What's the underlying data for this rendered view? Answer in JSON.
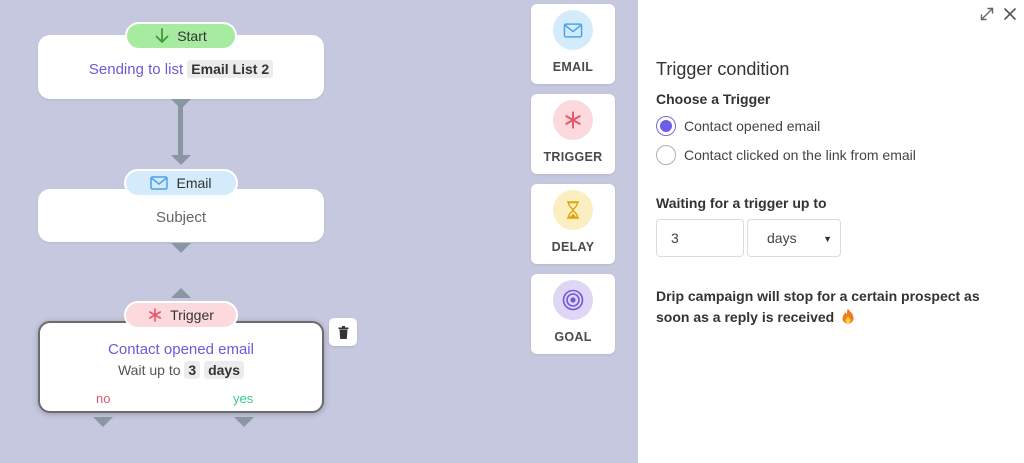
{
  "flow": {
    "start": {
      "pill_label": "Start",
      "text_prefix": "Sending to list",
      "list_name": "Email List 2"
    },
    "email": {
      "pill_label": "Email",
      "subject": "Subject"
    },
    "trigger": {
      "pill_label": "Trigger",
      "title": "Contact opened email",
      "wait_prefix": "Wait up to",
      "wait_value": "3",
      "wait_unit": "days",
      "branch_no": "no",
      "branch_yes": "yes"
    }
  },
  "palette": [
    {
      "label": "EMAIL",
      "icon": "envelope-icon",
      "color": "#d4ebfb"
    },
    {
      "label": "TRIGGER",
      "icon": "asterisk-icon",
      "color": "#fbd9dc"
    },
    {
      "label": "DELAY",
      "icon": "hourglass-icon",
      "color": "#fbeec0"
    },
    {
      "label": "GOAL",
      "icon": "target-icon",
      "color": "#ddd6f5"
    }
  ],
  "panel": {
    "title": "Trigger condition",
    "choose_label": "Choose a Trigger",
    "options": [
      {
        "label": "Contact opened email",
        "checked": true
      },
      {
        "label": "Contact clicked on the link from email",
        "checked": false
      }
    ],
    "waiting_label": "Waiting for a trigger up to",
    "waiting_value": "3",
    "waiting_unit": "days",
    "info": "Drip campaign will stop for a certain prospect as soon as a reply is received"
  },
  "colors": {
    "canvas_bg": "#c5c8de",
    "accent_purple": "#7157d9",
    "no_red": "#e05a6e",
    "yes_green": "#3ec98a"
  }
}
